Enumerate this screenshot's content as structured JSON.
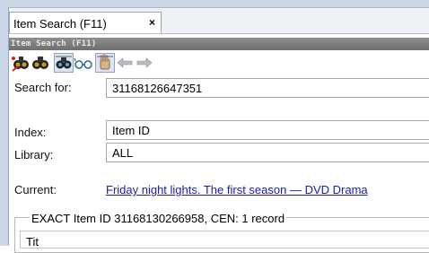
{
  "tab": {
    "label": "Item Search (F11)",
    "close_glyph": "×"
  },
  "panel": {
    "title": "Item Search (F11)"
  },
  "toolbar": {
    "icons": [
      "search-pin-icon",
      "search-icon",
      "search-advanced-icon",
      "glasses-icon",
      "hand-icon",
      "back-arrow-icon",
      "forward-arrow-icon"
    ]
  },
  "form": {
    "search_label": "Search for:",
    "search_value": "31168126647351",
    "index_label": "Index:",
    "index_value": "Item ID",
    "library_label": "Library:",
    "library_value": "ALL",
    "current_label": "Current:",
    "current_value": "Friday night lights. The first season — DVD Drama"
  },
  "results": {
    "title": "EXACT Item ID 31168130266958, CEN: 1 record",
    "partial_text": "Tit"
  },
  "colors": {
    "link": "#1a1ab3",
    "panel_bar": "#7a7a7a",
    "frame": "#c9d6e8"
  }
}
